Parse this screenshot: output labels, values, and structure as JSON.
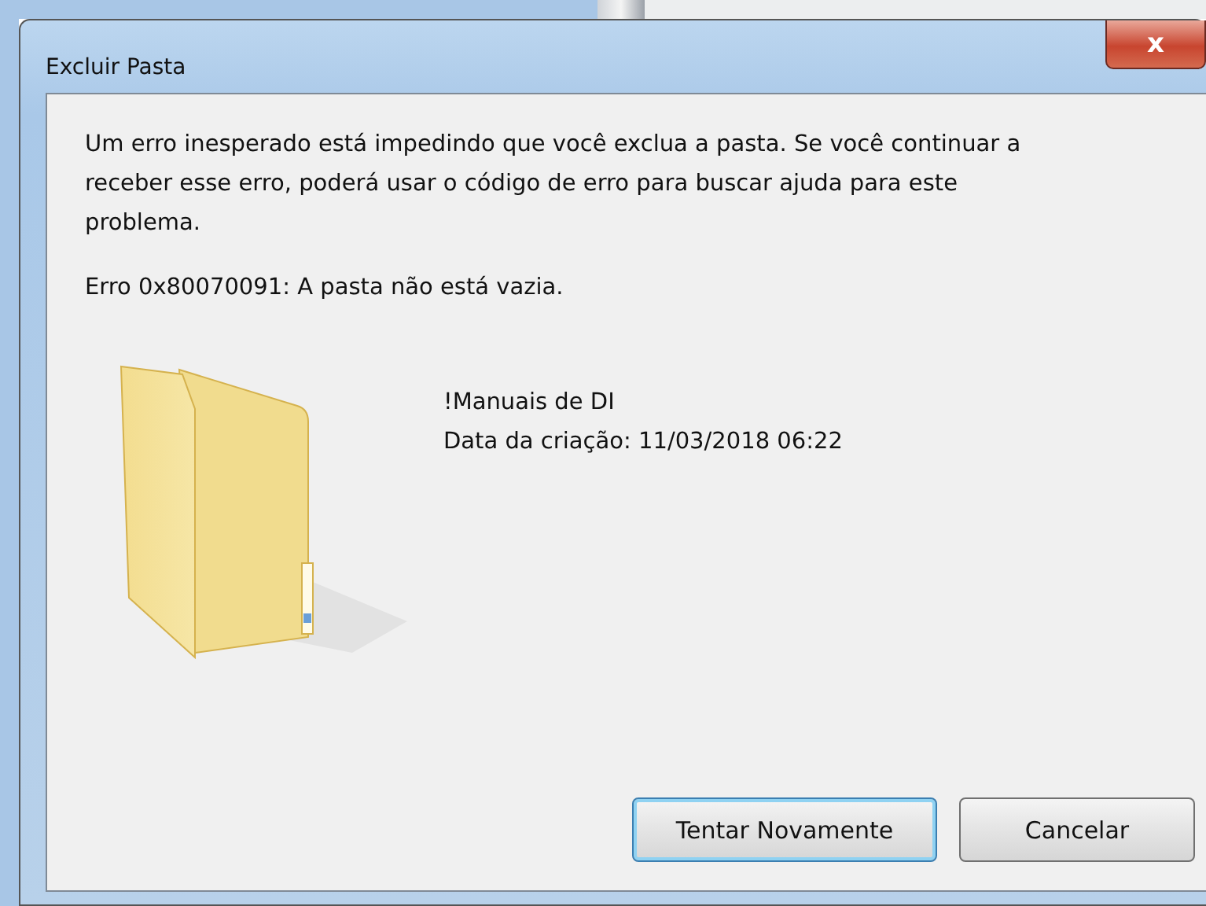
{
  "window": {
    "title": "Excluir Pasta",
    "close": "x"
  },
  "message": "Um erro inesperado está impedindo que você exclua a pasta. Se você continuar a receber esse erro, poderá usar o código de erro para buscar ajuda para este problema.",
  "error": "Erro 0x80070091: A pasta não está vazia.",
  "item": {
    "name": "!Manuais de DI",
    "created": "Data da criação: 11/03/2018 06:22"
  },
  "buttons": [
    {
      "label": "Tentar Novamente",
      "focused": true
    },
    {
      "label": "Cancelar",
      "focused": false
    }
  ]
}
